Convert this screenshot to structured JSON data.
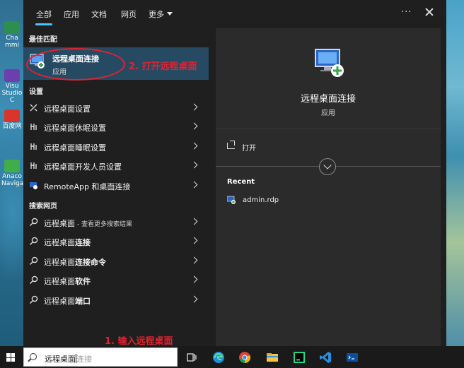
{
  "tabs": [
    {
      "label": "全部"
    },
    {
      "label": "应用"
    },
    {
      "label": "文档"
    },
    {
      "label": "网页"
    },
    {
      "label": "更多"
    }
  ],
  "header": {
    "more_options": "···"
  },
  "desktop_icons": [
    {
      "label": "Cha mmi"
    },
    {
      "label": "Visu Studio C"
    },
    {
      "label": "百度网"
    },
    {
      "label": "Anaco Naviga"
    }
  ],
  "sections": {
    "best_match": "最佳匹配",
    "settings": "设置",
    "web": "搜索网页"
  },
  "best_match": {
    "title": "远程桌面连接",
    "subtitle": "应用"
  },
  "settings_items": [
    {
      "label": "远程桌面设置"
    },
    {
      "label": "远程桌面休眠设置"
    },
    {
      "label": "远程桌面睡眠设置"
    },
    {
      "label": "远程桌面开发人员设置"
    },
    {
      "label": "RemoteApp 和桌面连接"
    }
  ],
  "web_items": [
    {
      "label": "远程桌面",
      "extra": " - 查看更多搜索结果"
    },
    {
      "label": "远程桌面",
      "bold": "连接"
    },
    {
      "label": "远程桌面",
      "bold": "连接命令"
    },
    {
      "label": "远程桌面",
      "bold": "软件"
    },
    {
      "label": "远程桌面",
      "bold": "端口"
    }
  ],
  "detail": {
    "title": "远程桌面连接",
    "subtitle": "应用",
    "open_label": "打开",
    "recent_label": "Recent",
    "recent_items": [
      {
        "label": "admin.rdp"
      }
    ]
  },
  "annotations": {
    "step1": "1. 输入远程桌面",
    "step2": "2. 打开远程桌面"
  },
  "search": {
    "typed": "远程桌面",
    "ghost": "连接"
  },
  "colors": {
    "accent": "#4cc2ff",
    "annotation": "#e5212f",
    "selected_row": "#274a63"
  }
}
